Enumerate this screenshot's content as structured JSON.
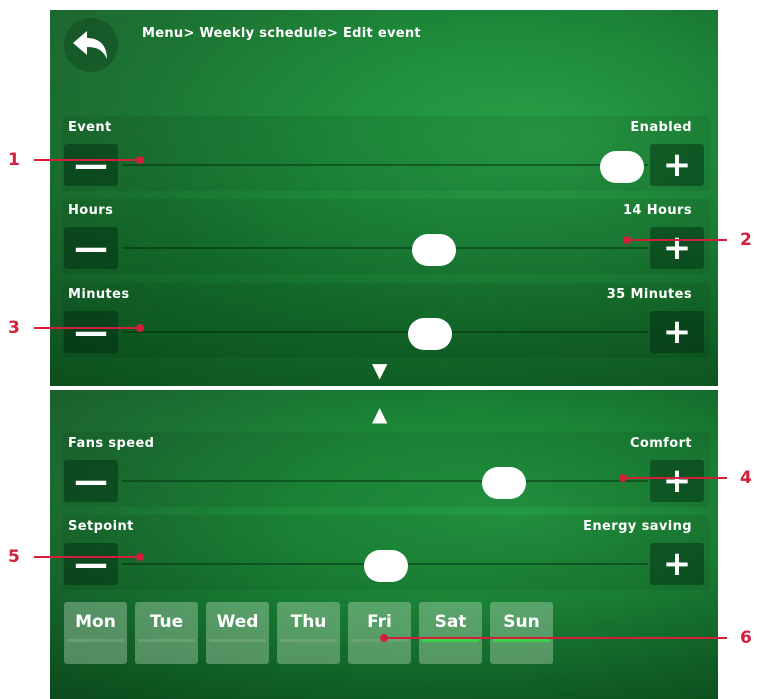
{
  "breadcrumb": "Menu> Weekly schedule> Edit event",
  "icons": {
    "back": "back-arrow-icon",
    "scroll_down": "triangle-down-icon",
    "scroll_up": "triangle-up-icon"
  },
  "buttons": {
    "minus": "—",
    "plus": "+"
  },
  "scroll": {
    "down": "▼",
    "up": "▲"
  },
  "settings": [
    {
      "label": "Event",
      "value": "Enabled"
    },
    {
      "label": "Hours",
      "value": "14 Hours"
    },
    {
      "label": "Minutes",
      "value": "35 Minutes"
    },
    {
      "label": "Fans speed",
      "value": "Comfort"
    },
    {
      "label": "Setpoint",
      "value": "Energy saving"
    }
  ],
  "days": [
    {
      "label": "Mon",
      "active": false
    },
    {
      "label": "Tue",
      "active": false
    },
    {
      "label": "Wed",
      "active": false
    },
    {
      "label": "Thu",
      "active": false
    },
    {
      "label": "Fri",
      "active": false
    },
    {
      "label": "Sat",
      "active": true
    },
    {
      "label": "Sun",
      "active": true
    }
  ],
  "callouts": [
    "1",
    "2",
    "3",
    "4",
    "5",
    "6"
  ],
  "colors": {
    "accent": "#d21f3c",
    "day_active": "#39d24a",
    "background": "#1f8f3c"
  }
}
